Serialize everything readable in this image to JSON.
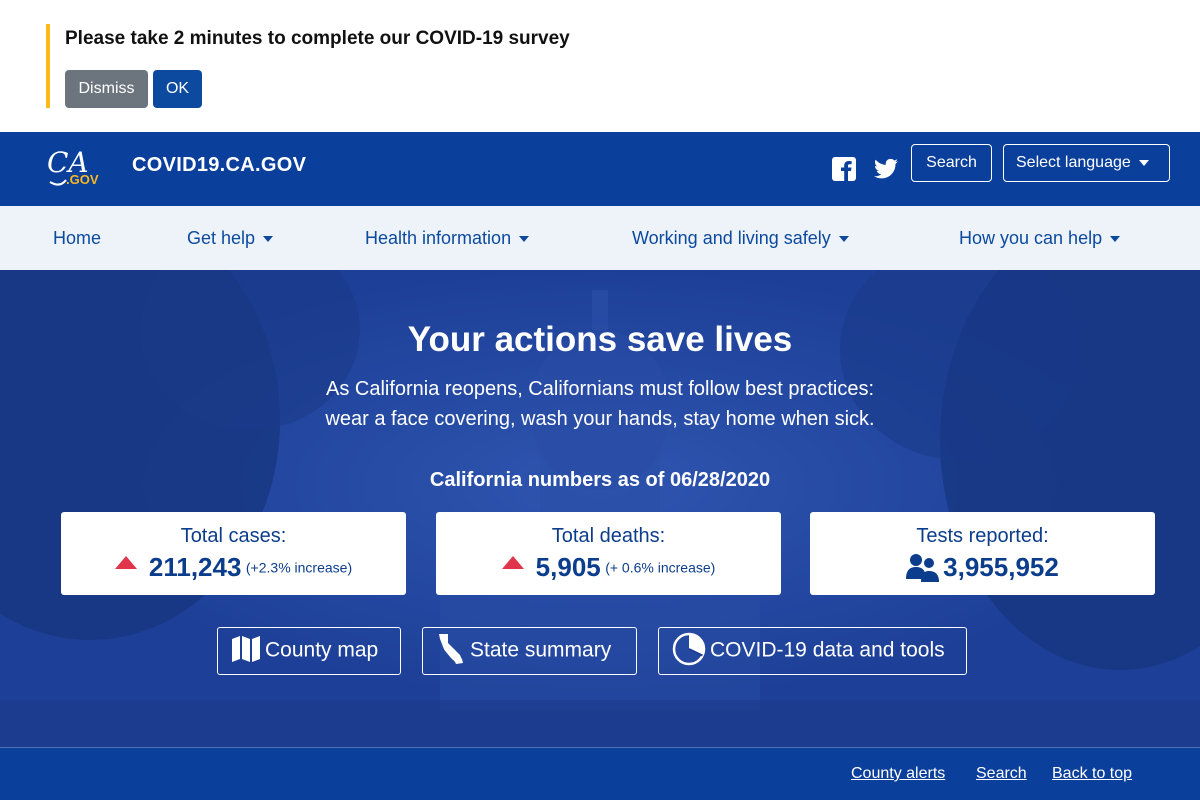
{
  "survey": {
    "message": "Please take 2 minutes to complete our COVID-19 survey",
    "dismiss_label": "Dismiss",
    "ok_label": "OK"
  },
  "header": {
    "logo_text": "CA",
    "logo_sub": ".GOV",
    "site_title": "COVID19.CA.GOV",
    "search_label": "Search",
    "language_label": "Select language"
  },
  "nav": {
    "items": [
      {
        "label": "Home"
      },
      {
        "label": "Get help"
      },
      {
        "label": "Health information"
      },
      {
        "label": "Working and living safely"
      },
      {
        "label": "How you can help"
      }
    ]
  },
  "hero": {
    "title": "Your actions save lives",
    "subtitle_line1": "As California reopens, Californians must follow best practices:",
    "subtitle_line2": "wear a face covering, wash your hands, stay home when sick.",
    "numbers_heading": "California numbers as of 06/28/2020",
    "stats": [
      {
        "label": "Total cases:",
        "value": "211,243",
        "increase": "(+2.3% increase)"
      },
      {
        "label": "Total deaths:",
        "value": "5,905",
        "increase": "(+ 0.6% increase)"
      },
      {
        "label": "Tests reported:",
        "value": "3,955,952"
      }
    ],
    "actions": [
      {
        "label": "County map"
      },
      {
        "label": "State summary"
      },
      {
        "label": "COVID-19 data and tools"
      }
    ]
  },
  "footer": {
    "links": [
      {
        "label": "County alerts"
      },
      {
        "label": "Search"
      },
      {
        "label": "Back to top"
      }
    ]
  },
  "colors": {
    "primary": "#0a3f9b",
    "survey_accent": "#fdb81e",
    "increase_arrow": "#e0354b",
    "nav_bg": "#eef2f9"
  }
}
